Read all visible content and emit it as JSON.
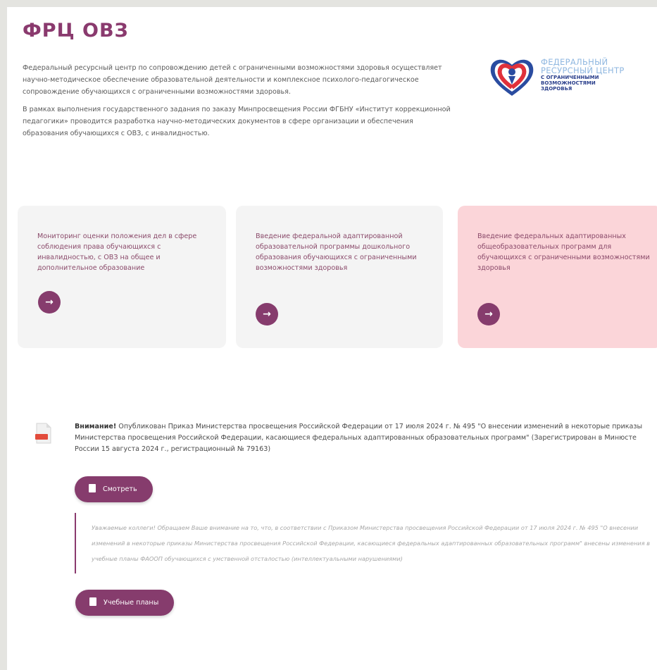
{
  "header": {
    "title": "ФРЦ ОВЗ"
  },
  "intro": {
    "paragraph1": "Федеральный ресурсный центр по сопровождению детей с ограниченными возможностями здоровья осуществляет научно-методическое обеспечение образовательной деятельности и комплексное психолого-педагогическое сопровождение обучающихся с ограниченными возможностями здоровья.",
    "paragraph2": "В рамках выполнения государственного задания по заказу Минпросвещения России ФГБНУ «Институт коррекционной педагогики» проводится разработка научно-методических документов в сфере организации и обеспечения образования обучающихся с ОВЗ, с инвалидностью."
  },
  "logo": {
    "line1": "ФЕДЕРАЛЬНЫЙ",
    "line2": "РЕСУРСНЫЙ ЦЕНТР",
    "line3": "С ОГРАНИЧЕННЫМИ",
    "line4": "ВОЗМОЖНОСТЯМИ",
    "line5": "ЗДОРОВЬЯ"
  },
  "cards": [
    {
      "text": "Мониторинг оценки положения дел в сфере соблюдения права обучающихся с инвалидностью, с ОВЗ на общее и дополнительное образование",
      "button_icon": "→"
    },
    {
      "text": "Введение федеральной адаптированной образовательной программы дошкольного образования обучающихся с ограниченными возможностями здоровья",
      "button_icon": "→"
    },
    {
      "text": "Введение федеральных адаптированных общеобразовательных программ для обучающихся с ограниченными возможностями здоровья",
      "button_icon": "→"
    }
  ],
  "notice": {
    "bold": "Внимание!",
    "text": " Опубликован Приказ Министерства просвещения Российской Федерации от 17 июля 2024 г. № 495 \"О внесении изменений в некоторые приказы Министерства просвещения Российской Федерации, касающиеся федеральных адаптированных образовательных программ\" (Зарегистрирован в Минюсте России 15 августа 2024 г., регистрационный № 79163)",
    "view_button": "Смотреть"
  },
  "quote": {
    "text": "Уважаемые коллеги! Обращаем Ваше внимание на то, что, в соответствии с Приказом Министерства просвещения Российской Федерации от 17 июля 2024 г. № 495 \"О внесении изменений в некоторые приказы Министерства просвещения Российской Федерации, касающиеся федеральных адаптированных образовательных программ\" внесены изменения в учебные планы ФАООП обучающихся с умственной отсталостью (интеллектуальными нарушениями)"
  },
  "plans_button": "Учебные планы",
  "colors": {
    "accent": "#863c6d",
    "card": "#f4f4f4",
    "card_active": "#fbd5d9"
  }
}
